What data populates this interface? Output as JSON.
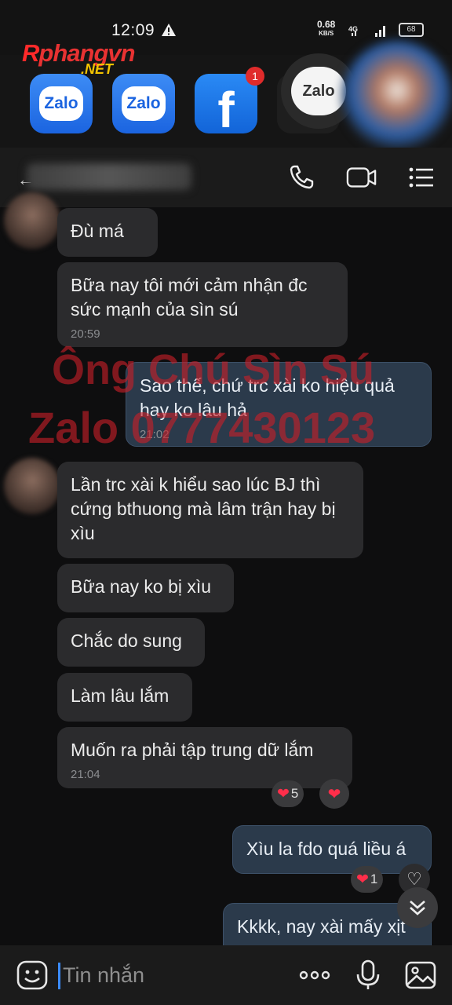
{
  "status": {
    "time": "12:09",
    "speed_value": "0.68",
    "speed_unit": "KB/S",
    "network": "4G",
    "battery": "68"
  },
  "logo": {
    "r": "R",
    "rest": "phangvn",
    "net": ".NET"
  },
  "apps": {
    "zalo1": "Zalo",
    "zalo2": "Zalo",
    "facebook": "f",
    "facebook_badge": "1",
    "zalo_bubble": "Zalo"
  },
  "messages": [
    {
      "dir": "in",
      "text": "Đù má"
    },
    {
      "dir": "in",
      "text": "Bữa nay tôi mới cảm nhận đc sức mạnh của sìn sú",
      "time": "20:59"
    },
    {
      "dir": "out",
      "text": "Sao thế, chứ trc xài ko hiệu quả hay ko lâu hả",
      "time": "21:02"
    },
    {
      "dir": "in",
      "text": "Lần trc xài k hiểu sao lúc BJ thì cứng bthuong mà lâm trận hay bị xìu"
    },
    {
      "dir": "in",
      "text": "Bữa nay ko bị xìu"
    },
    {
      "dir": "in",
      "text": "Chắc do sung"
    },
    {
      "dir": "in",
      "text": "Làm lâu lắm"
    },
    {
      "dir": "in",
      "text": "Muốn ra phải tập trung dữ lắm",
      "time": "21:04",
      "reaction_count": "5"
    },
    {
      "dir": "out",
      "text": "Xìu la fdo quá liều á",
      "reaction_count": "1"
    },
    {
      "dir": "out",
      "text": "Kkkk, nay xài mấy xịt"
    }
  ],
  "watermark": {
    "line1": "Ông Chú Sìn Sú",
    "line2": "Zalo 0777430123"
  },
  "input": {
    "placeholder": "Tin nhắn"
  },
  "colors": {
    "background": "#0e0e0f",
    "incoming_bubble": "#2b2b2d",
    "outgoing_bubble": "#2b3a4b",
    "heart": "#ff2e4a",
    "watermark": "#c81e28",
    "cursor": "#3b8cff"
  }
}
